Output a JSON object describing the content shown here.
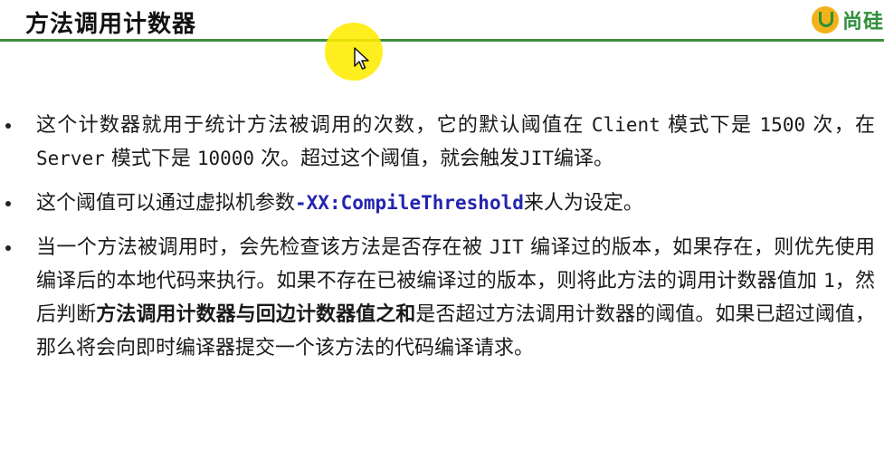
{
  "slide": {
    "title": "方法调用计数器",
    "logo_text": "尚硅",
    "accent_color": "#3f8f3f",
    "highlight_color": "#ffec00",
    "code_color": "#2424b0"
  },
  "bullets": [
    {
      "part1": "这个计数器就用于统计方法被调用的次数，它的默认阈值在 ",
      "client": "Client",
      "part2": " 模式下是 ",
      "n1500": "1500",
      "part3": " 次，在 ",
      "server": "Server",
      "part4": " 模式下是 ",
      "n10000": "10000",
      "part5": " 次。超过这个阈值，就会触发",
      "jit": "JIT",
      "part6": "编译。"
    },
    {
      "part1": "这个阈值可以通过虚拟机参数",
      "code": "-XX:CompileThreshold",
      "part2": "来人为设定。"
    },
    {
      "part1": "当一个方法被调用时，会先检查该方法是否存在被 ",
      "jit": "JIT",
      "part2": " 编译过的版本，如果存在，则优先使用编译后的本地代码来执行。如果不存在已被编译过的版本，则将此方法的调用计数器值加 ",
      "one": "1",
      "part3": "，然后判断",
      "bold": "方法调用计数器与回边计数器值之和",
      "part4": "是否超过方法调用计数器的阈值。如果已超过阈值，那么将会向即时编译器提交一个该方法的代码编译请求。"
    }
  ]
}
